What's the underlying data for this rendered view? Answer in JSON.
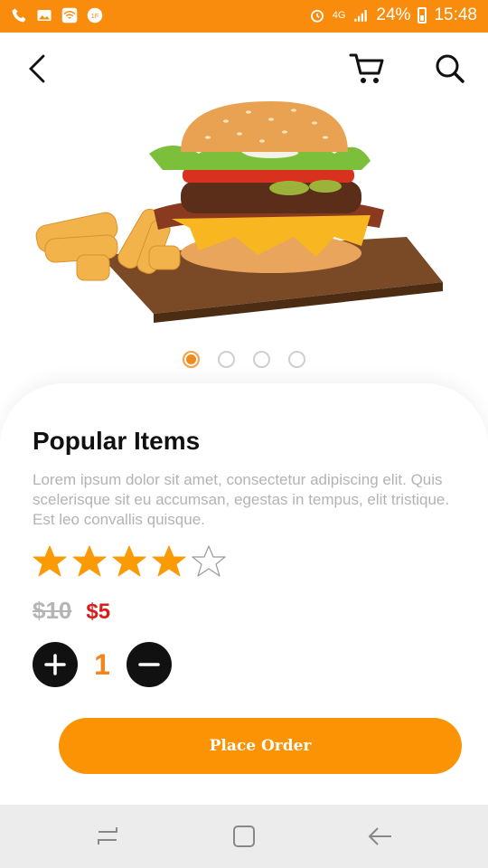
{
  "status_bar": {
    "battery": "24%",
    "time": "15:48",
    "network": "4G",
    "icons": [
      "phone-icon",
      "image-icon",
      "wifi-icon",
      "vpn-icon",
      "alarm-icon",
      "signal-icon",
      "battery-icon"
    ]
  },
  "header": {
    "icons": [
      "back-arrow-icon",
      "cart-icon",
      "search-icon"
    ]
  },
  "carousel": {
    "image": "burger-with-fries",
    "active_index": 0,
    "total": 4
  },
  "product": {
    "title": "Popular Items",
    "description": "Lorem ipsum dolor sit amet, consectetur adipiscing elit. Quis scelerisque sit eu accumsan, egestas in tempus, elit tristique. Est leo convallis quisque.",
    "rating": 4,
    "rating_max": 5,
    "old_price": "$10",
    "new_price": "$5",
    "quantity": "1"
  },
  "actions": {
    "order_label": "Place Order"
  },
  "colors": {
    "accent": "#fb9304",
    "status_bar": "#f98c0c",
    "price_red": "#d91c1c",
    "star": "#fa9a05"
  },
  "navbar": {
    "icons": [
      "recent-apps-icon",
      "home-icon",
      "back-icon"
    ]
  }
}
